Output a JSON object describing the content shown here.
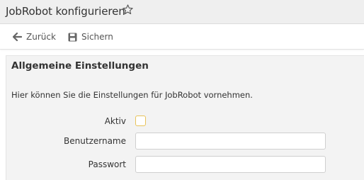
{
  "header": {
    "title": "JobRobot konfigurieren",
    "favorite_icon": "star-outline-icon"
  },
  "toolbar": {
    "back_label": "Zurück",
    "back_icon": "arrow-left-icon",
    "save_label": "Sichern",
    "save_icon": "floppy-disk-icon"
  },
  "panel": {
    "title": "Allgemeine Einstellungen",
    "description": "Hier können Sie die Einstellungen für JobRobot vornehmen.",
    "fields": {
      "active": {
        "label": "Aktiv",
        "checked": false
      },
      "username": {
        "label": "Benutzername",
        "value": "",
        "placeholder": ""
      },
      "password": {
        "label": "Passwort",
        "value": "",
        "placeholder": ""
      }
    }
  },
  "colors": {
    "header_bg": "#efefef",
    "panel_bg": "#f3f3f3",
    "checkbox_border": "#e8c35a"
  }
}
